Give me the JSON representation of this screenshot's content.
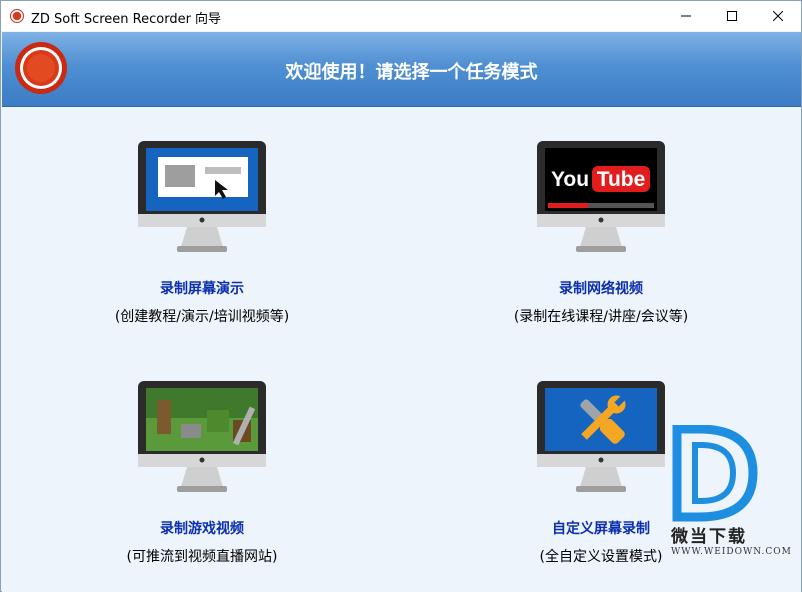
{
  "window": {
    "title": "ZD Soft Screen Recorder 向导"
  },
  "banner": {
    "title": "欢迎使用！请选择一个任务模式"
  },
  "tasks": [
    {
      "title": "录制屏幕演示",
      "desc": "(创建教程/演示/培训视频等)",
      "icon": "screen-presentation-icon"
    },
    {
      "title": "录制网络视频",
      "desc": "(录制在线课程/讲座/会议等)",
      "icon": "youtube-icon"
    },
    {
      "title": "录制游戏视频",
      "desc": "(可推流到视频直播网站)",
      "icon": "game-scene-icon"
    },
    {
      "title": "自定义屏幕录制",
      "desc": "(全自定义设置模式)",
      "icon": "tools-icon"
    }
  ],
  "youtube_logo": {
    "you": "You",
    "tube": "Tube"
  },
  "watermark": {
    "text": "微当下载",
    "url": "WWW.WEIDOWN.COM"
  },
  "colors": {
    "accent": "#3b7cc4",
    "task_title": "#0b2fb0",
    "record_red": "#d93a1a"
  }
}
